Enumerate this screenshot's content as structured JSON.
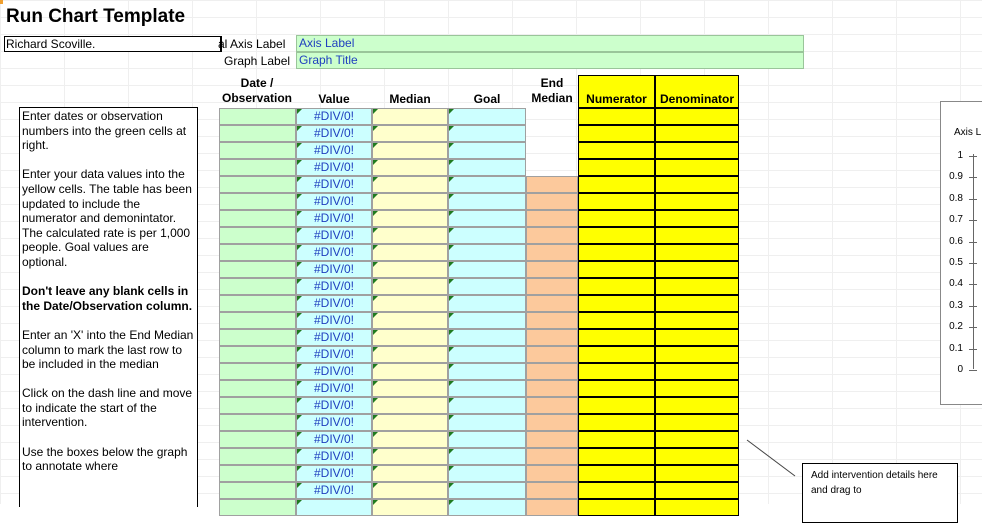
{
  "title": "Run Chart Template",
  "author_cell": "Richard Scoville.",
  "axis_label_caption": "al Axis Label",
  "axis_label_value": "Axis Label",
  "graph_label_caption": "Graph Label",
  "graph_label_value": "Graph Title",
  "headers": {
    "date_obs": "Date / Observation",
    "value": "Value",
    "median": "Median",
    "goal": "Goal",
    "end_median": "End Median",
    "numerator": "Numerator",
    "denominator": "Denominator"
  },
  "value_cells": [
    "#DIV/0!",
    "#DIV/0!",
    "#DIV/0!",
    "#DIV/0!",
    "#DIV/0!",
    "#DIV/0!",
    "#DIV/0!",
    "#DIV/0!",
    "#DIV/0!",
    "#DIV/0!",
    "#DIV/0!",
    "#DIV/0!",
    "#DIV/0!",
    "#DIV/0!",
    "#DIV/0!",
    "#DIV/0!",
    "#DIV/0!",
    "#DIV/0!",
    "#DIV/0!",
    "#DIV/0!",
    "#DIV/0!",
    "#DIV/0!",
    "#DIV/0!"
  ],
  "instructions": {
    "p1": "Enter dates or observation numbers into the green cells at right.",
    "p2": "Enter your data values into the yellow  cells. The table has been updated to include the numerator  and demonintator.  The calculated rate is per 1,000 people. Goal values are optional.",
    "p3": "Don't leave any blank cells in the Date/Observation column.",
    "p4": "Enter an 'X' into the End Median column to mark the last row to be included in the median",
    "p5": "Click on the dash line and move to indicate the start of the intervention.",
    "p6": "Use the boxes below the graph to annotate where"
  },
  "chart": {
    "axis_label": "Axis L",
    "ticks": [
      "1",
      "0.9",
      "0.8",
      "0.7",
      "0.6",
      "0.5",
      "0.4",
      "0.3",
      "0.2",
      "0.1",
      "0"
    ]
  },
  "note_box": "Add intervention details here and drag to",
  "colors": {
    "green": "#ccffcc",
    "blue_cell": "#ccffff",
    "cream": "#ffffcc",
    "peach": "#fcc99c",
    "yellow": "#ffff00",
    "link_blue": "#1f3fbf"
  }
}
